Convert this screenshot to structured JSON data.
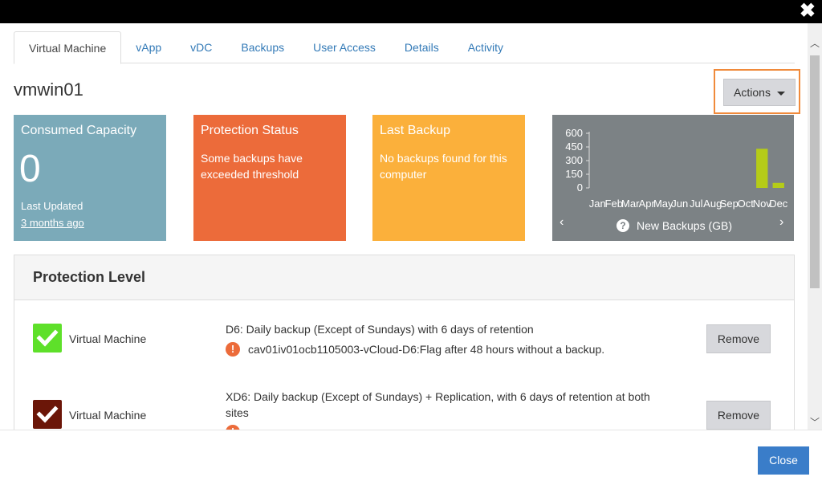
{
  "window": {
    "close_glyph": "✖"
  },
  "tabs": [
    {
      "label": "Virtual Machine",
      "active": true
    },
    {
      "label": "vApp"
    },
    {
      "label": "vDC"
    },
    {
      "label": "Backups"
    },
    {
      "label": "User Access"
    },
    {
      "label": "Details"
    },
    {
      "label": "Activity"
    }
  ],
  "vm": {
    "name": "vmwin01"
  },
  "actions": {
    "label": "Actions"
  },
  "tiles": {
    "capacity": {
      "title": "Consumed Capacity",
      "value": "0",
      "updated_label": "Last Updated",
      "updated_link": "3 months ago",
      "color": "#7baab9"
    },
    "protection": {
      "title": "Protection Status",
      "text": "Some backups have exceeded threshold",
      "color": "#ec6b3a"
    },
    "last_backup": {
      "title": "Last Backup",
      "text": "No backups found for this computer",
      "color": "#fbb03b"
    },
    "chart": {
      "caption": "New Backups (GB)",
      "help_icon": "question-circle-icon",
      "prev_glyph": "‹",
      "next_glyph": "›",
      "color": "#7c8285"
    }
  },
  "chart_data": {
    "type": "bar",
    "categories": [
      "Jan",
      "Feb",
      "Mar",
      "Apr",
      "May",
      "Jun",
      "Jul",
      "Aug",
      "Sep",
      "Oct",
      "Nov",
      "Dec"
    ],
    "values": [
      0,
      0,
      0,
      0,
      0,
      0,
      0,
      0,
      0,
      0,
      430,
      55
    ],
    "yticks": [
      0,
      150,
      300,
      450,
      600
    ],
    "ylim": [
      0,
      600
    ],
    "bar_color": "#b5cc18",
    "title": "",
    "xlabel": "",
    "ylabel": ""
  },
  "protection": {
    "heading": "Protection Level",
    "rows": [
      {
        "label": "Virtual Machine",
        "check_color": "#5ee02a",
        "policy": "D6: Daily backup (Except of Sundays) with 6 days of retention",
        "warning": "cav01iv01ocb1105003-vCloud-D6:Flag after 48 hours without a backup.",
        "remove": "Remove"
      },
      {
        "label": "Virtual Machine",
        "check_color": "#6b1608",
        "policy": "XD6: Daily backup (Except of Sundays) + Replication, with 6 days of retention at both sites",
        "remove": "Remove"
      }
    ],
    "warning_glyph": "!"
  },
  "footer": {
    "close": "Close"
  }
}
